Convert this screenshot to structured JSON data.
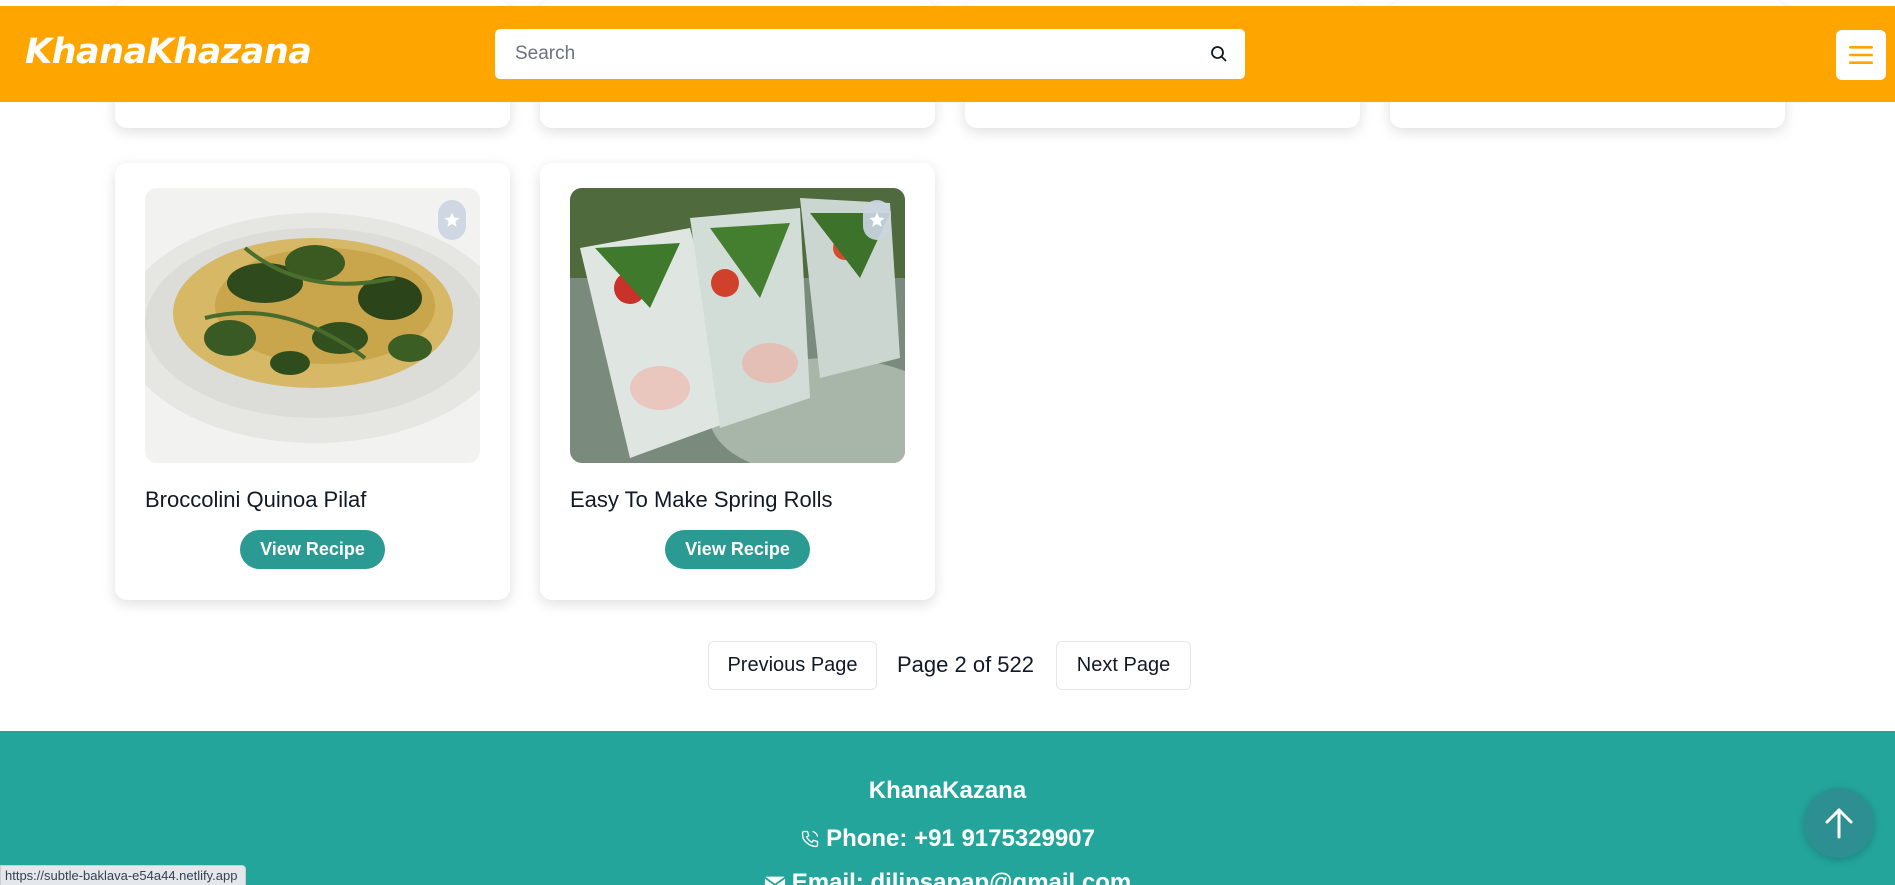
{
  "header": {
    "brand": "KhanaKhazana",
    "search_placeholder": "Search"
  },
  "recipes": [
    {
      "title": "Broccolini Quinoa Pilaf",
      "button_label": "View Recipe"
    },
    {
      "title": "Easy To Make Spring Rolls",
      "button_label": "View Recipe"
    }
  ],
  "pagination": {
    "previous_label": "Previous Page",
    "page_info": "Page 2 of 522",
    "next_label": "Next Page"
  },
  "footer": {
    "brand": "KhanaKazana",
    "phone": "Phone: +91 9175329907",
    "email": "Email: dilipsapap@gmail.com"
  },
  "status_bar": {
    "url": "https://subtle-baklava-e54a44.netlify.app"
  },
  "colors": {
    "header_bg": "#ffa500",
    "accent_teal": "#2a9a93",
    "footer_bg": "#23a59b"
  },
  "icons": [
    "search-icon",
    "hamburger-menu-icon",
    "star-icon",
    "phone-icon",
    "mail-icon",
    "arrow-up-icon"
  ]
}
